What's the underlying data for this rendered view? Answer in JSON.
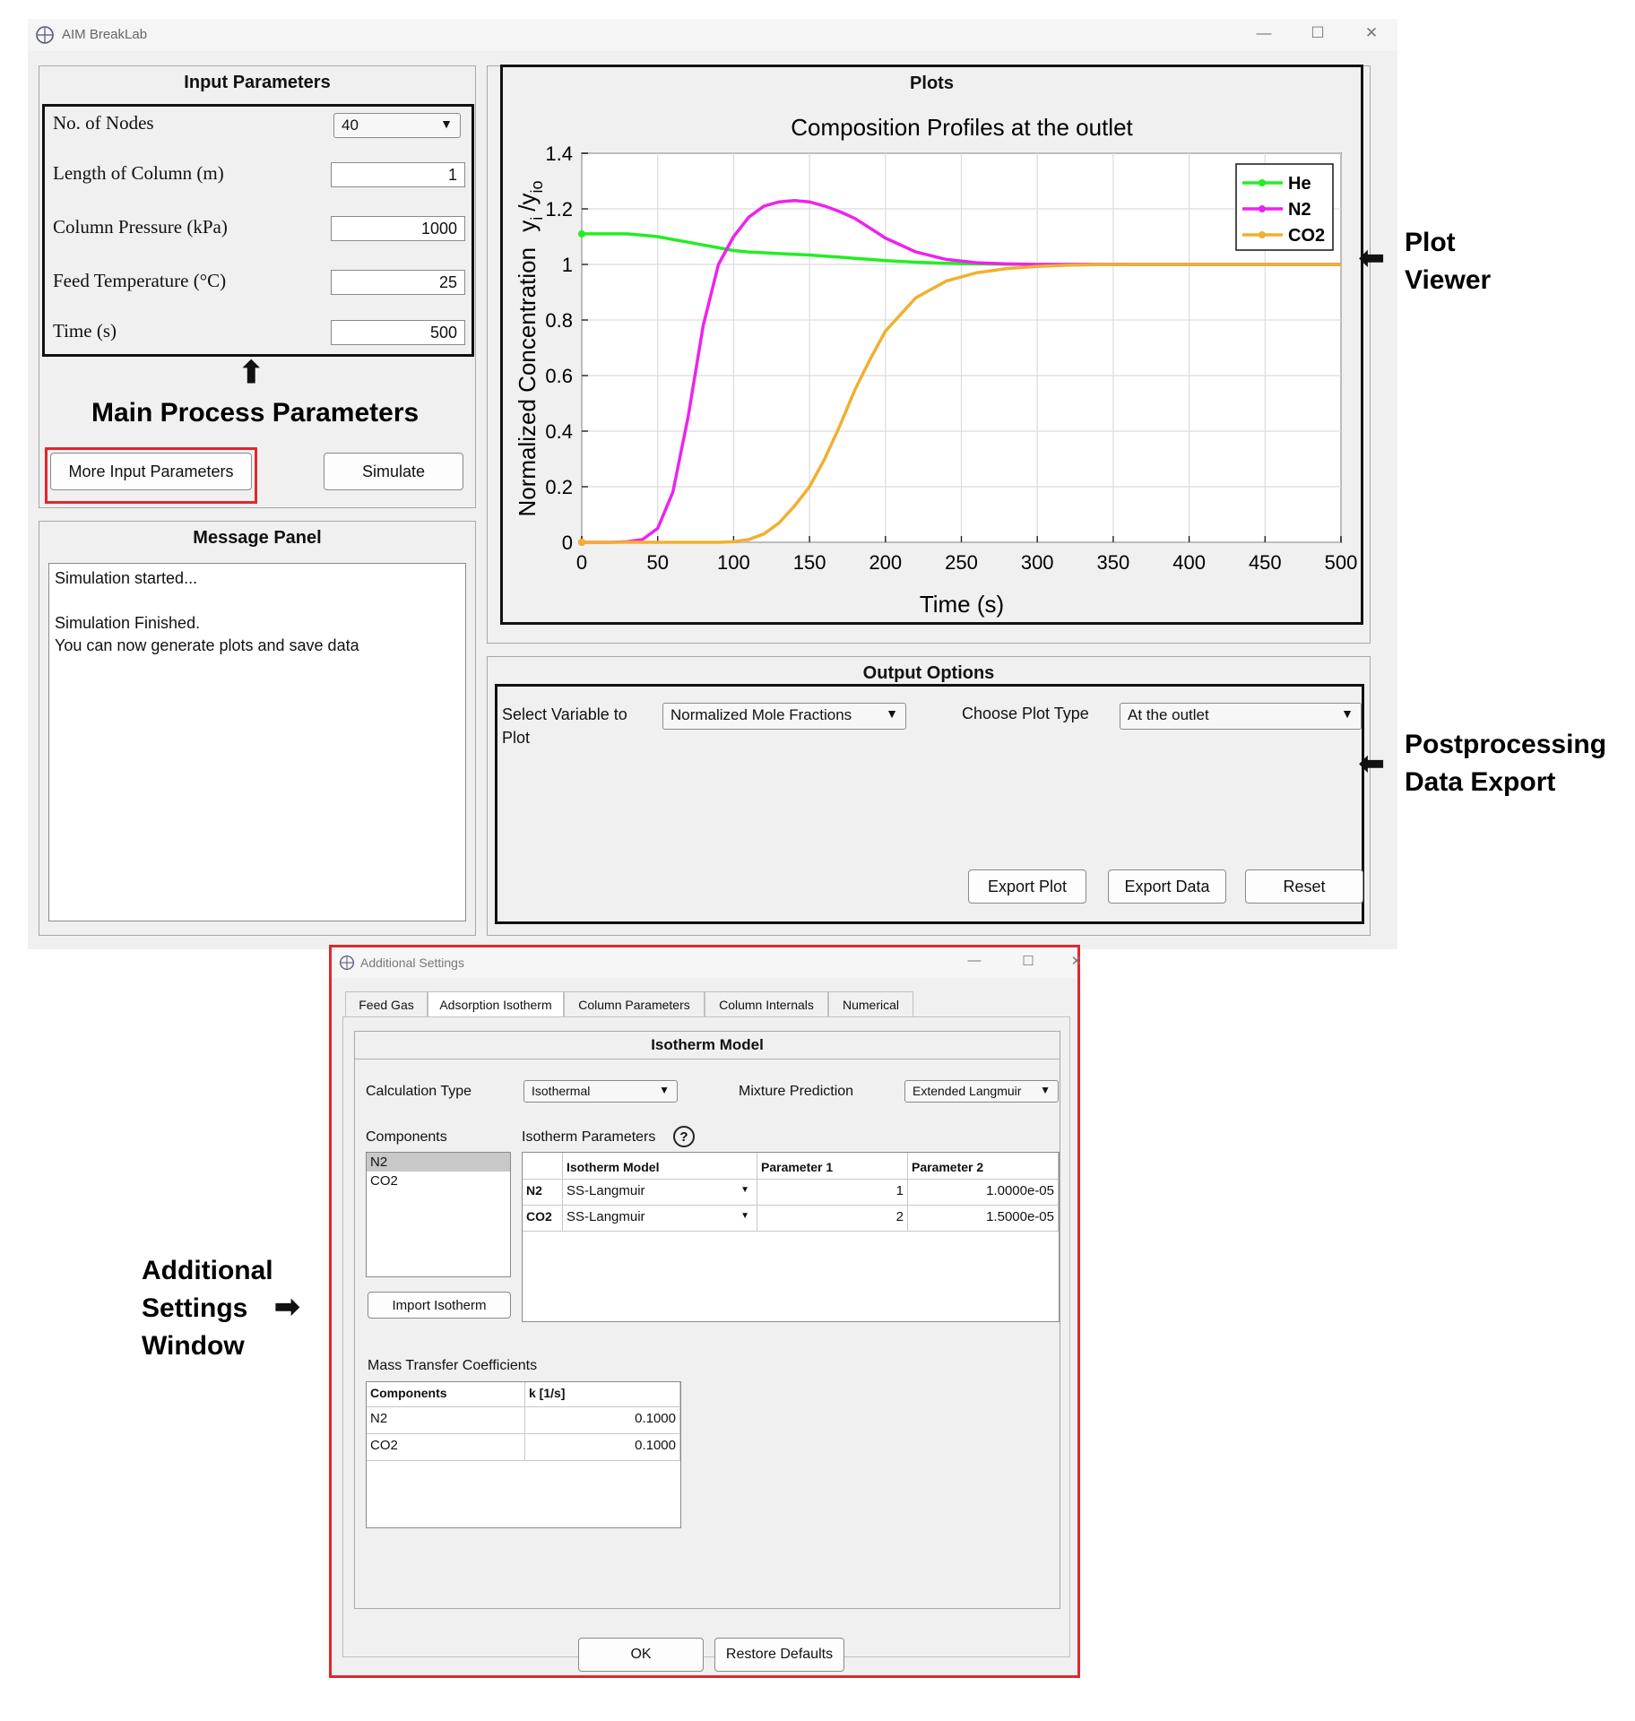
{
  "main_window": {
    "title": "AIM BreakLab",
    "controls": {
      "minimize": "—",
      "maximize": "☐",
      "close": "✕"
    }
  },
  "input_panel": {
    "title": "Input Parameters",
    "params": [
      {
        "label": "No. of Nodes",
        "value": "40",
        "kind": "dropdown"
      },
      {
        "label": "Length of Column (m)",
        "value": "1",
        "kind": "field"
      },
      {
        "label": "Column Pressure (kPa)",
        "value": "1000",
        "kind": "field"
      },
      {
        "label": "Feed Temperature (°C)",
        "value": "25",
        "kind": "field"
      },
      {
        "label": "Time (s)",
        "value": "500",
        "kind": "field"
      }
    ],
    "more_button": "More Input Parameters",
    "simulate_button": "Simulate"
  },
  "message_panel": {
    "title": "Message Panel",
    "lines": [
      "Simulation started...",
      "",
      "Simulation Finished.",
      "You can now generate plots and save data"
    ]
  },
  "plots_panel": {
    "title": "Plots"
  },
  "chart_data": {
    "type": "line",
    "title": "Composition Profiles at the outlet",
    "xlabel": "Time (s)",
    "ylabel_main": "Normalized Concentration",
    "ylabel_sym": "y",
    "ylabel_sub_i": "i",
    "ylabel_slash": "/y",
    "ylabel_sub_io": "io",
    "xlim": [
      0,
      500
    ],
    "ylim": [
      0,
      1.4
    ],
    "xticks": [
      0,
      50,
      100,
      150,
      200,
      250,
      300,
      350,
      400,
      450,
      500
    ],
    "xtick_labels": [
      "0",
      "50",
      "100",
      "150",
      "200",
      "250",
      "300",
      "350",
      "400",
      "450",
      "500"
    ],
    "yticks": [
      0,
      0.2,
      0.4,
      0.6,
      0.8,
      1,
      1.2,
      1.4
    ],
    "ytick_labels": [
      "0",
      "0.2",
      "0.4",
      "0.6",
      "0.8",
      "1",
      "1.2",
      "1.4"
    ],
    "grid": true,
    "legend_position": "top-right",
    "x": [
      0,
      10,
      20,
      30,
      40,
      50,
      60,
      70,
      80,
      90,
      100,
      110,
      120,
      130,
      140,
      150,
      160,
      170,
      180,
      190,
      200,
      220,
      240,
      260,
      280,
      300,
      320,
      340,
      360,
      380,
      400,
      450,
      500
    ],
    "series": [
      {
        "name": "He",
        "color": "#22ee22",
        "values": [
          1.11,
          1.11,
          1.11,
          1.11,
          1.105,
          1.1,
          1.09,
          1.08,
          1.07,
          1.06,
          1.05,
          1.045,
          1.042,
          1.039,
          1.036,
          1.034,
          1.03,
          1.026,
          1.022,
          1.018,
          1.014,
          1.008,
          1.004,
          1.002,
          1.001,
          1.0,
          1.0,
          1.0,
          1.0,
          1.0,
          1.0,
          1.0,
          1.0
        ]
      },
      {
        "name": "N2",
        "color": "#ee22ee",
        "values": [
          0,
          0,
          0,
          0.002,
          0.01,
          0.05,
          0.18,
          0.45,
          0.78,
          1.0,
          1.1,
          1.17,
          1.21,
          1.225,
          1.23,
          1.225,
          1.21,
          1.19,
          1.165,
          1.13,
          1.095,
          1.045,
          1.018,
          1.006,
          1.002,
          1.0,
          1.0,
          1.0,
          1.0,
          1.0,
          1.0,
          1.0,
          1.0
        ]
      },
      {
        "name": "CO2",
        "color": "#f0b030",
        "values": [
          0,
          0,
          0,
          0,
          0,
          0,
          0,
          0,
          0,
          0,
          0.002,
          0.01,
          0.03,
          0.07,
          0.13,
          0.2,
          0.3,
          0.42,
          0.55,
          0.66,
          0.76,
          0.88,
          0.94,
          0.97,
          0.985,
          0.993,
          0.997,
          0.999,
          1.0,
          1.0,
          1.0,
          1.0,
          1.0
        ]
      }
    ]
  },
  "output_panel": {
    "title": "Output Options",
    "select_var_label": "Select Variable to\nPlot",
    "select_var_line1": "Select Variable to",
    "select_var_line2": "Plot",
    "select_var_value": "Normalized Mole Fractions",
    "plot_type_label": "Choose Plot Type",
    "plot_type_value": "At the outlet",
    "export_plot": "Export Plot",
    "export_data": "Export Data",
    "reset": "Reset"
  },
  "annotations": {
    "main_params": "Main Process Parameters",
    "plot_viewer_1": "Plot",
    "plot_viewer_2": "Viewer",
    "post_1": "Postprocessing",
    "post_2": "Data Export",
    "add_1": "Additional",
    "add_2": "Settings",
    "add_3": "Window"
  },
  "additional_window": {
    "title": "Additional Settings",
    "tabs": [
      "Feed Gas",
      "Adsorption Isotherm",
      "Column Parameters",
      "Column Internals",
      "Numerical"
    ],
    "active_tab": "Adsorption Isotherm",
    "section_title": "Isotherm Model",
    "calc_type_label": "Calculation Type",
    "calc_type_value": "Isothermal",
    "mixture_label": "Mixture Prediction",
    "mixture_value": "Extended Langmuir",
    "components_label": "Components",
    "components": [
      "N2",
      "CO2"
    ],
    "isotherm_params_label": "Isotherm Parameters",
    "help_icon": "?",
    "iso_table": {
      "headers": [
        "",
        "Isotherm Model",
        "Parameter 1",
        "Parameter 2"
      ],
      "rows": [
        {
          "name": "N2",
          "model": "SS-Langmuir",
          "p1": "1",
          "p2": "1.0000e-05"
        },
        {
          "name": "CO2",
          "model": "SS-Langmuir",
          "p1": "2",
          "p2": "1.5000e-05"
        }
      ]
    },
    "import_button": "Import Isotherm",
    "mass_transfer_label": "Mass Transfer Coefficients",
    "mt_table": {
      "headers": [
        "Components",
        "k [1/s]"
      ],
      "rows": [
        {
          "name": "N2",
          "k": "0.1000"
        },
        {
          "name": "CO2",
          "k": "0.1000"
        }
      ]
    },
    "ok_button": "OK",
    "restore_button": "Restore Defaults"
  }
}
